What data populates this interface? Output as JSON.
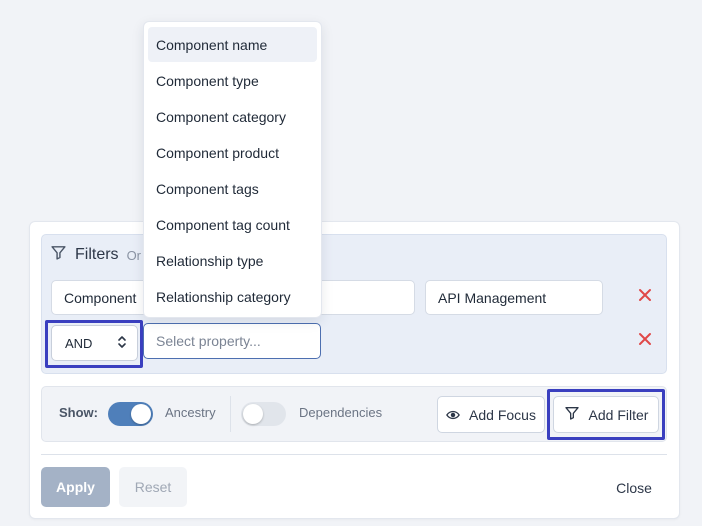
{
  "filters": {
    "title": "Filters",
    "hint": "Or",
    "row1": {
      "property": "Component",
      "value": "API Management"
    },
    "row2": {
      "operator": "AND",
      "property_placeholder": "Select property..."
    }
  },
  "dropdown": {
    "items": [
      "Component name",
      "Component type",
      "Component category",
      "Component product",
      "Component tags",
      "Component tag count",
      "Relationship type",
      "Relationship category"
    ],
    "highlighted_index": 0
  },
  "show": {
    "label": "Show:",
    "ancestry_label": "Ancestry",
    "ancestry_on": true,
    "dependencies_label": "Dependencies",
    "dependencies_on": false
  },
  "actions": {
    "add_focus": "Add Focus",
    "add_filter": "Add Filter",
    "apply": "Apply",
    "reset": "Reset",
    "close": "Close"
  },
  "colors": {
    "highlight_outline": "#3a3fbf",
    "toggle_on": "#4f7fba",
    "remove_x": "#e04848",
    "apply_disabled": "#a4b2c6"
  },
  "icons": {
    "filter": "funnel-icon",
    "remove": "close-x-icon",
    "select_arrows": "chevron-up-down-icon",
    "focus": "eye-icon"
  }
}
